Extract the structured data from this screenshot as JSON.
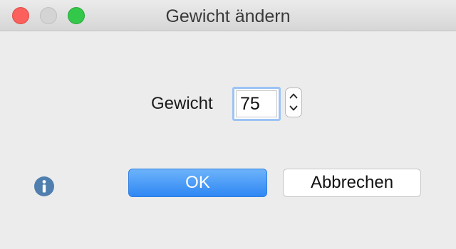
{
  "window": {
    "title": "Gewicht ändern"
  },
  "form": {
    "weight_label": "Gewicht",
    "weight_value": "75"
  },
  "buttons": {
    "ok_label": "OK",
    "cancel_label": "Abbrechen"
  },
  "icons": {
    "info": "info-icon",
    "stepper_up": "chevron-up-icon",
    "stepper_down": "chevron-down-icon"
  },
  "colors": {
    "accent": "#3d8ef5",
    "info_icon": "#4f7fae",
    "close": "#fc605c",
    "maximize": "#34c84a"
  }
}
